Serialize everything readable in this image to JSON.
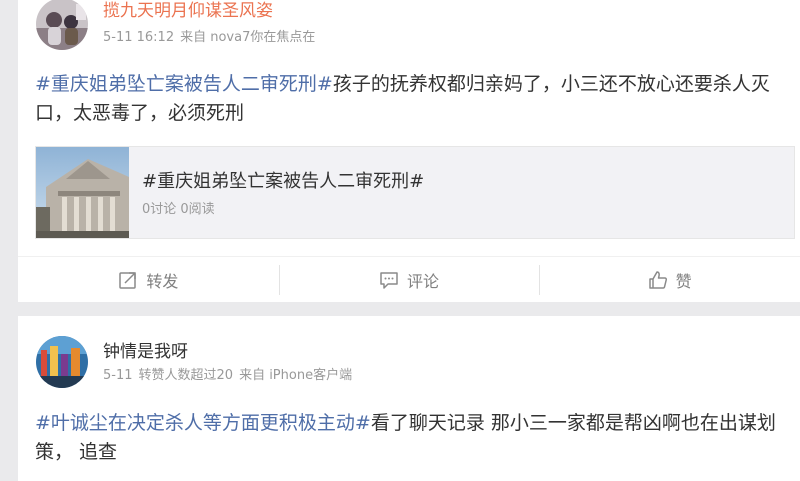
{
  "posts": [
    {
      "username": "揽九天明月仰谋圣风姿",
      "date": "5-11 16:12",
      "source": "来自 nova7你在焦点在",
      "topic": "#重庆姐弟坠亡案被告人二审死刑#",
      "text": "孩子的抚养权都归亲妈了，小三还不放心还要杀人灭口，太恶毒了，必须死刑",
      "topic_card": {
        "title": "#重庆姐弟坠亡案被告人二审死刑#",
        "stats": "0讨论 0阅读"
      },
      "actions": {
        "repost_label": "转发",
        "comment_label": "评论",
        "like_label": "赞"
      }
    },
    {
      "username": "钟情是我呀",
      "date": "5-11",
      "repost_info": "转赞人数超过20",
      "source": "来自 iPhone客户端",
      "topic": "#叶诚尘在决定杀人等方面更积极主动#",
      "text": "看了聊天记录 那小三一家都是帮凶啊也在出谋划策， 追查"
    }
  ],
  "colors": {
    "accent": "#eb7350",
    "topic_link": "#4f6ea8",
    "meta_gray": "#999999",
    "background": "#eaeaec"
  },
  "icons": [
    "repost-icon",
    "comment-icon",
    "like-icon"
  ]
}
